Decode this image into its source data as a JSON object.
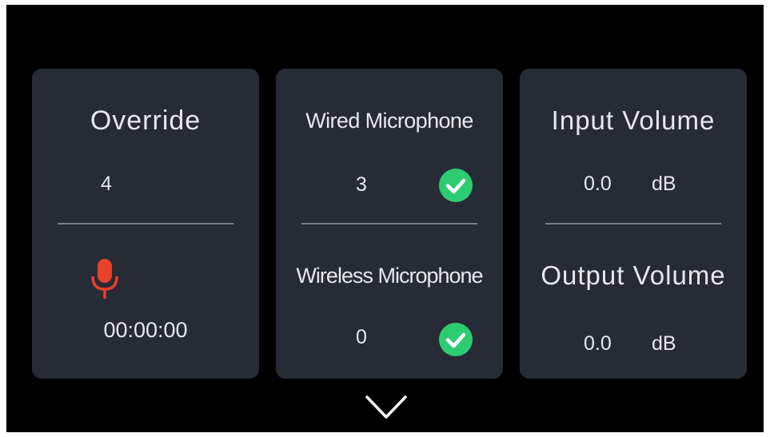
{
  "override": {
    "title": "Override",
    "count": "4",
    "timer": "00:00:00",
    "mic_color": "#e8412c"
  },
  "microphones": {
    "wired": {
      "title": "Wired Microphone",
      "count": "3",
      "status": "check-icon"
    },
    "wireless": {
      "title": "Wireless Microphone",
      "count": "0",
      "status": "check-icon"
    },
    "check_color": "#2ecc71"
  },
  "volume": {
    "input": {
      "title": "Input Volume",
      "value": "0.0",
      "unit": "dB"
    },
    "output": {
      "title": "Output Volume",
      "value": "0.0",
      "unit": "dB"
    }
  },
  "navigation": {
    "expand_icon": "chevron-down-icon"
  },
  "colors": {
    "background": "#000000",
    "card": "#262b35",
    "text": "#e6e8ec",
    "divider": "#7b7f87"
  }
}
